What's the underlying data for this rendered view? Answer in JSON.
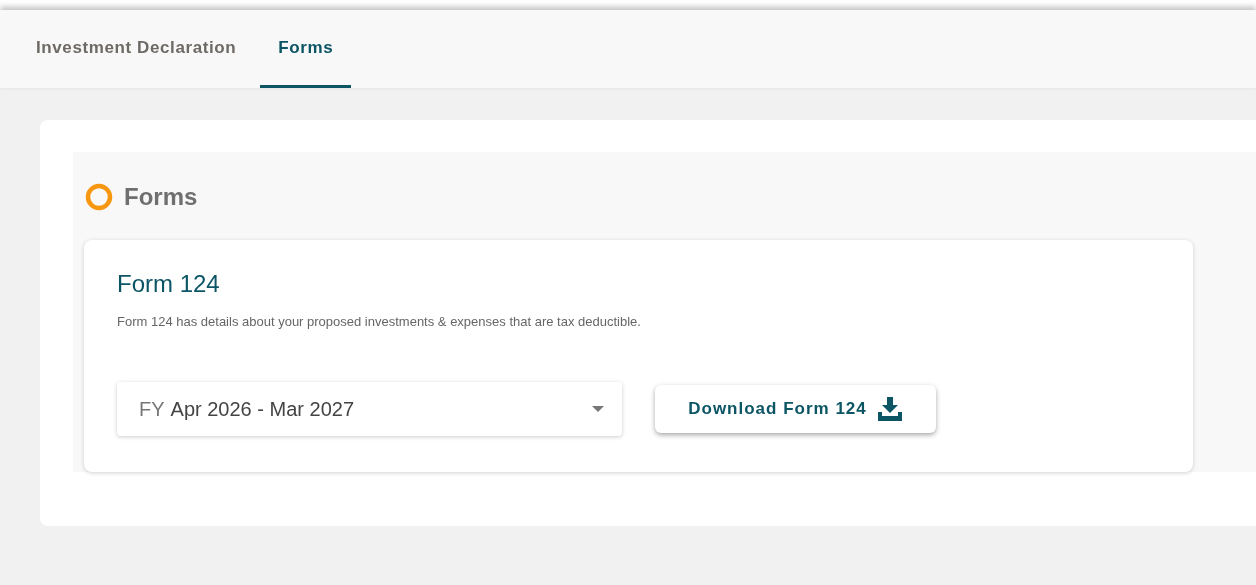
{
  "tabs": [
    {
      "label": "Investment Declaration",
      "selected": false
    },
    {
      "label": "Forms",
      "selected": true
    }
  ],
  "section": {
    "title": "Forms"
  },
  "form_card": {
    "title": "Form 124",
    "description": "Form 124 has details about your proposed investments & expenses that are tax deductible.",
    "period_select": {
      "prefix": "FY",
      "value": "Apr 2026 - Mar 2027"
    },
    "download_button": {
      "label": "Download Form 124"
    }
  }
}
